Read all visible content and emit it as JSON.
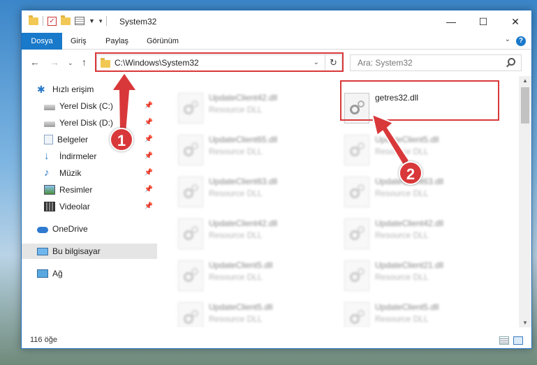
{
  "window": {
    "title": "System32"
  },
  "ribbon": {
    "tabs": [
      "Dosya",
      "Giriş",
      "Paylaş",
      "Görünüm"
    ],
    "help": "?"
  },
  "nav": {
    "address": "C:\\Windows\\System32",
    "search_placeholder": "Ara: System32"
  },
  "sidebar": {
    "items": [
      {
        "label": "Hızlı erişim",
        "icon": "star-icon",
        "pinned": false
      },
      {
        "label": "Yerel Disk (C:)",
        "icon": "drive-icon",
        "pinned": true
      },
      {
        "label": "Yerel Disk (D:)",
        "icon": "drive-icon",
        "pinned": true
      },
      {
        "label": "Belgeler",
        "icon": "documents-icon",
        "pinned": true
      },
      {
        "label": "İndirmeler",
        "icon": "download-icon",
        "pinned": true
      },
      {
        "label": "Müzik",
        "icon": "music-icon",
        "pinned": true
      },
      {
        "label": "Resimler",
        "icon": "pictures-icon",
        "pinned": true
      },
      {
        "label": "Videolar",
        "icon": "videos-icon",
        "pinned": true
      },
      {
        "label": "OneDrive",
        "icon": "onedrive-icon",
        "pinned": false
      },
      {
        "label": "Bu bilgisayar",
        "icon": "computer-icon",
        "pinned": false,
        "selected": true
      },
      {
        "label": "Ağ",
        "icon": "network-icon",
        "pinned": false
      }
    ]
  },
  "files": {
    "left": [
      {
        "name": "UpdateClient42.dll",
        "type": "Resource DLL"
      },
      {
        "name": "UpdateClient65.dll",
        "type": "Resource DLL"
      },
      {
        "name": "UpdateClient63.dll",
        "type": "Resource DLL"
      },
      {
        "name": "UpdateClient42.dll",
        "type": "Resource DLL"
      },
      {
        "name": "UpdateClient5.dll",
        "type": "Resource DLL"
      },
      {
        "name": "UpdateClient5.dll",
        "type": "Resource DLL"
      }
    ],
    "highlighted": {
      "name": "getres32.dll"
    },
    "right": [
      {
        "name": "UpdateClient5.dll",
        "type": "Resource DLL"
      },
      {
        "name": "UpdateClient63.dll",
        "type": "Resource DLL"
      },
      {
        "name": "UpdateClient42.dll",
        "type": "Resource DLL"
      },
      {
        "name": "UpdateClient21.dll",
        "type": "Resource DLL"
      },
      {
        "name": "UpdateClient5.dll",
        "type": "Resource DLL"
      }
    ]
  },
  "status": {
    "item_count": "116 öğe"
  },
  "annotations": {
    "step1": "1",
    "step2": "2",
    "color": "#d9383a"
  }
}
